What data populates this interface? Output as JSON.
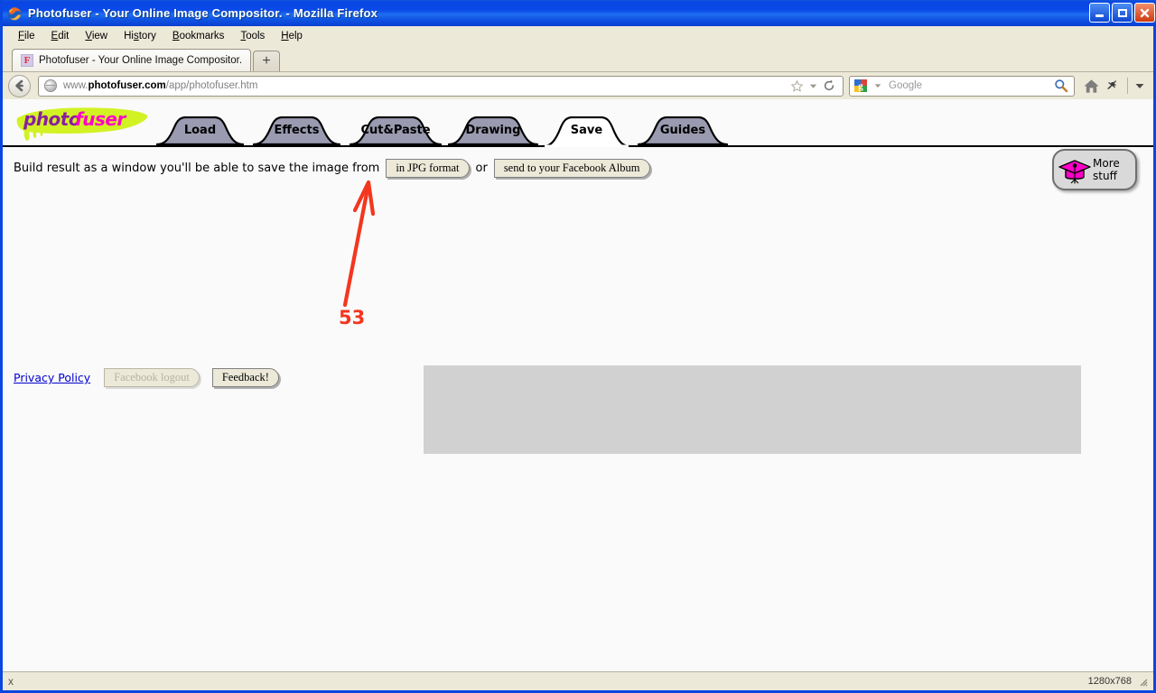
{
  "window": {
    "title": "Photofuser - Your Online Image Compositor. - Mozilla Firefox",
    "controls": {
      "minimize": "minimize",
      "maximize": "maximize",
      "close": "close"
    }
  },
  "menubar": {
    "items": [
      {
        "pre": "",
        "key": "F",
        "post": "ile"
      },
      {
        "pre": "",
        "key": "E",
        "post": "dit"
      },
      {
        "pre": "",
        "key": "V",
        "post": "iew"
      },
      {
        "pre": "Hi",
        "key": "s",
        "post": "tory"
      },
      {
        "pre": "",
        "key": "B",
        "post": "ookmarks"
      },
      {
        "pre": "",
        "key": "T",
        "post": "ools"
      },
      {
        "pre": "",
        "key": "H",
        "post": "elp"
      }
    ]
  },
  "browser_tabs": {
    "active_tab_title": "Photofuser - Your Online Image Compositor.",
    "favicon_letter": "F",
    "new_tab_label": "+"
  },
  "navbar": {
    "back_label": "Back",
    "url_prefix": "www.",
    "url_domain": "photofuser.com",
    "url_path": "/app/photofuser.htm",
    "bookmark_icon": "star-icon",
    "bookmark_dropdown_icon": "chevron-down-icon",
    "reload_icon": "reload-icon",
    "search_engine": "Google",
    "search_value": "",
    "search_placeholder": "Google",
    "home_icon": "home-icon",
    "extras_icon": "extras-icon",
    "overflow_icon": "chevron-down-icon"
  },
  "page": {
    "logo": {
      "part1": "photo",
      "part2": "fuser"
    },
    "tabs": [
      {
        "label": "Load",
        "active": false
      },
      {
        "label": "Effects",
        "active": false
      },
      {
        "label": "Cut&Paste",
        "active": false
      },
      {
        "label": "Drawing",
        "active": false
      },
      {
        "label": "Save",
        "active": true
      },
      {
        "label": "Guides",
        "active": false
      }
    ],
    "build_row": {
      "intro": "Build result as a window you'll be able to save the image from",
      "jpg_button": "in JPG format",
      "or": "or",
      "facebook_button": "send to your Facebook Album"
    },
    "more_stuff": {
      "line1": "More",
      "line2": "stuff",
      "icon": "graduation-cap-icon"
    },
    "footer": {
      "privacy_policy": "Privacy Policy",
      "facebook_logout": "Facebook logout",
      "feedback": "Feedback!"
    }
  },
  "annotation": {
    "number": "53",
    "color": "#f4361f",
    "target": "in JPG format"
  },
  "statusbar": {
    "left_icon": "close-icon",
    "left_label": "x",
    "dimensions": "1280x768"
  },
  "colors": {
    "titlebar_blue": "#0a46e4",
    "chrome_beige": "#ece9d8",
    "page_bg": "#fafafa",
    "tab_inactive": "#9a9ab0",
    "tab_active": "#ffffff",
    "logo_purple": "#8a1f9e",
    "logo_magenta": "#ff00c8",
    "logo_highlight": "#d2f224",
    "link_blue": "#0000cc",
    "gray_box": "#d1d1d1",
    "annotation_red": "#f4361f",
    "cap_magenta": "#ff00c8"
  }
}
